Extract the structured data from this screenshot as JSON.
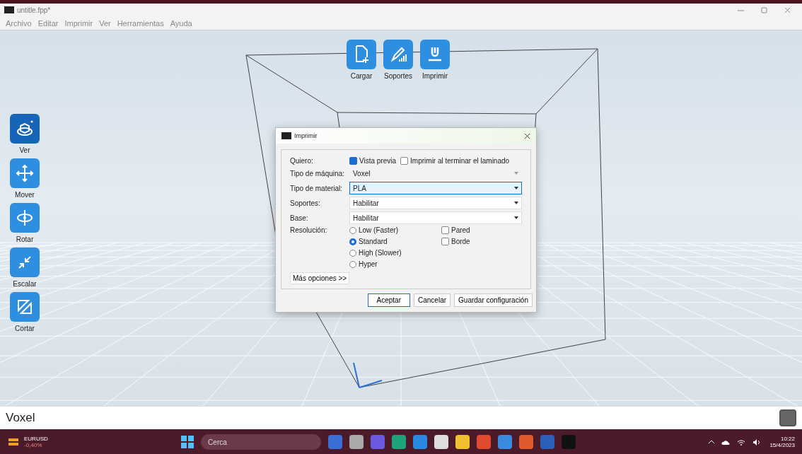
{
  "window": {
    "title": "untitle.fpp*"
  },
  "menu": [
    "Archivo",
    "Editar",
    "Imprimir",
    "Ver",
    "Herramientas",
    "Ayuda"
  ],
  "top_toolbar": [
    {
      "label": "Cargar",
      "kind": "load"
    },
    {
      "label": "Soportes",
      "kind": "supports"
    },
    {
      "label": "Imprimir",
      "kind": "print"
    }
  ],
  "side_toolbar": [
    {
      "label": "Ver",
      "kind": "view",
      "selected": true
    },
    {
      "label": "Mover",
      "kind": "move",
      "selected": false
    },
    {
      "label": "Rotar",
      "kind": "rotate",
      "selected": false
    },
    {
      "label": "Escalar",
      "kind": "scale",
      "selected": false
    },
    {
      "label": "Cortar",
      "kind": "cut",
      "selected": false
    }
  ],
  "dialog": {
    "title": "Imprimir",
    "want_label": "Quiero:",
    "want_options": [
      {
        "label": "Vista previa",
        "checked": true
      },
      {
        "label": "Imprimir al terminar el laminado",
        "checked": false
      }
    ],
    "fields": [
      {
        "label": "Tipo de máquina:",
        "value": "Voxel",
        "disabled": true,
        "focused": false
      },
      {
        "label": "Tipo de material:",
        "value": "PLA",
        "disabled": false,
        "focused": true
      },
      {
        "label": "Soportes:",
        "value": "Habilitar",
        "disabled": false,
        "focused": false
      },
      {
        "label": "Base:",
        "value": "Habilitar",
        "disabled": false,
        "focused": false
      }
    ],
    "resolution_label": "Resolución:",
    "resolutions": [
      {
        "label": "Low (Faster)",
        "selected": false
      },
      {
        "label": "Standard",
        "selected": true
      },
      {
        "label": "High (Slower)",
        "selected": false
      },
      {
        "label": "Hyper",
        "selected": false
      }
    ],
    "extras": [
      {
        "label": "Pared",
        "checked": false
      },
      {
        "label": "Borde",
        "checked": false
      }
    ],
    "more_button": "Más opciones >>",
    "buttons": [
      {
        "label": "Aceptar",
        "default": true
      },
      {
        "label": "Cancelar",
        "default": false
      },
      {
        "label": "Guardar configuración",
        "default": false
      }
    ]
  },
  "status_bar": {
    "text": "Voxel"
  },
  "taskbar": {
    "ticker": {
      "symbol": "EURUSD",
      "change": "-0,40%"
    },
    "search": {
      "placeholder": "Cerca"
    },
    "time": "10:22",
    "date": "15/4/2023"
  }
}
